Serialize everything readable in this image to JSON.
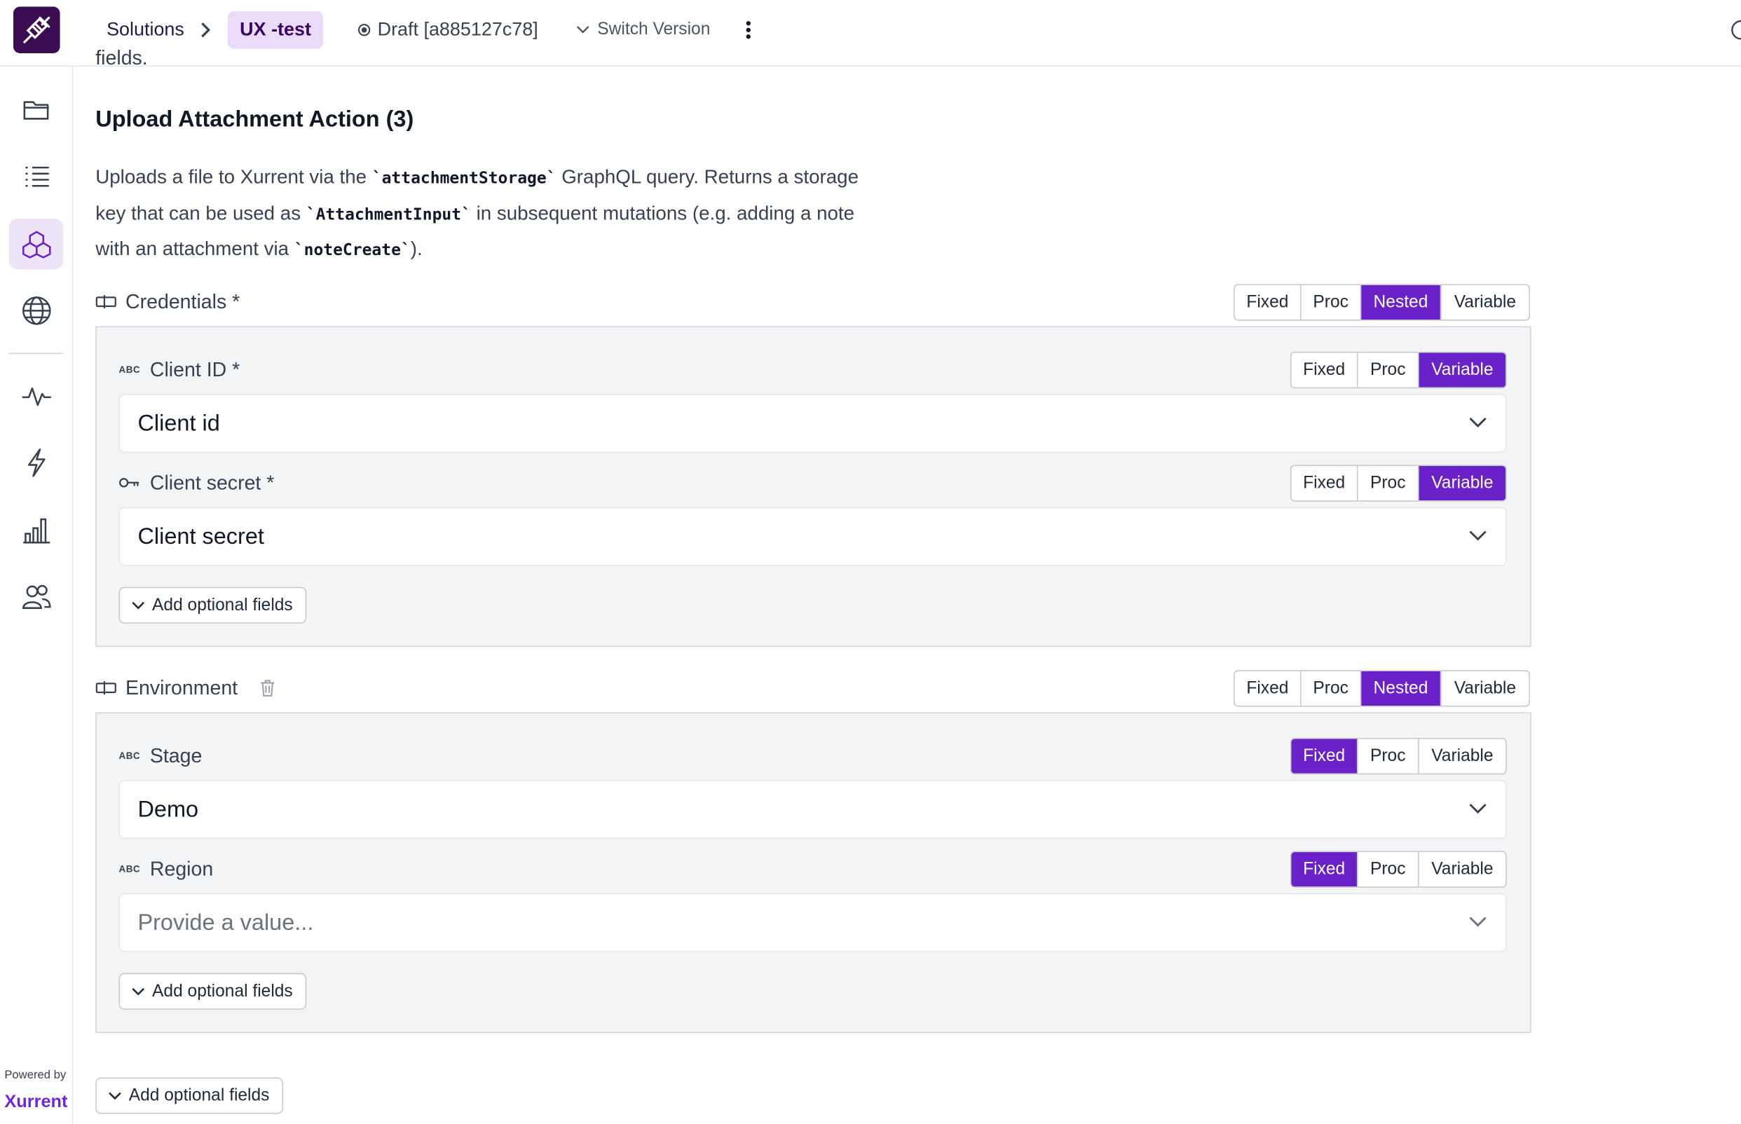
{
  "header": {
    "breadcrumb_root": "Solutions",
    "breadcrumb_current": "UX -test",
    "draft_label": "Draft [a885127c78]",
    "switch_version_label": "Switch Version"
  },
  "sidebar": {
    "items": [
      {
        "icon": "folder-icon"
      },
      {
        "icon": "list-icon"
      },
      {
        "icon": "cubes-icon",
        "active": true
      },
      {
        "icon": "globe-icon"
      },
      {
        "icon": "activity-icon"
      },
      {
        "icon": "lightning-icon"
      },
      {
        "icon": "bar-chart-icon"
      },
      {
        "icon": "users-icon"
      }
    ],
    "powered_by": "Powered by",
    "brand": "Xurrent"
  },
  "main": {
    "cut_text": "fields.",
    "section_title": "Upload Attachment Action (3)",
    "description": {
      "part1": "Uploads a file to Xurrent via the ",
      "code1": "`attachmentStorage`",
      "part2": " GraphQL query. Returns a storage key that can be used as ",
      "code2": "`AttachmentInput`",
      "part3": " in subsequent mutations (e.g. adding a note with an attachment via ",
      "code3": "`noteCreate`",
      "part4": ")."
    },
    "credentials": {
      "label": "Credentials *",
      "modes": [
        "Fixed",
        "Proc",
        "Nested",
        "Variable"
      ],
      "selected_mode": "Nested",
      "fields": [
        {
          "label": "Client ID *",
          "type_badge": "ABC",
          "modes": [
            "Fixed",
            "Proc",
            "Variable"
          ],
          "selected_mode": "Variable",
          "value": "Client id"
        },
        {
          "label": "Client secret *",
          "type_badge": "key-icon",
          "modes": [
            "Fixed",
            "Proc",
            "Variable"
          ],
          "selected_mode": "Variable",
          "value": "Client secret"
        }
      ],
      "add_optional_label": "Add optional fields"
    },
    "environment": {
      "label": "Environment",
      "modes": [
        "Fixed",
        "Proc",
        "Nested",
        "Variable"
      ],
      "selected_mode": "Nested",
      "fields": [
        {
          "label": "Stage",
          "type_badge": "ABC",
          "modes": [
            "Fixed",
            "Proc",
            "Variable"
          ],
          "selected_mode": "Fixed",
          "value": "Demo"
        },
        {
          "label": "Region",
          "type_badge": "ABC",
          "modes": [
            "Fixed",
            "Proc",
            "Variable"
          ],
          "selected_mode": "Fixed",
          "placeholder": "Provide a value..."
        }
      ],
      "add_optional_label": "Add optional fields"
    },
    "add_optional_label": "Add optional fields"
  },
  "colors": {
    "accent": "#6b21c8",
    "active_tab_bg": "#eadcf8",
    "logo_bg": "#3b0c52",
    "brand_text": "#6d28d9"
  }
}
